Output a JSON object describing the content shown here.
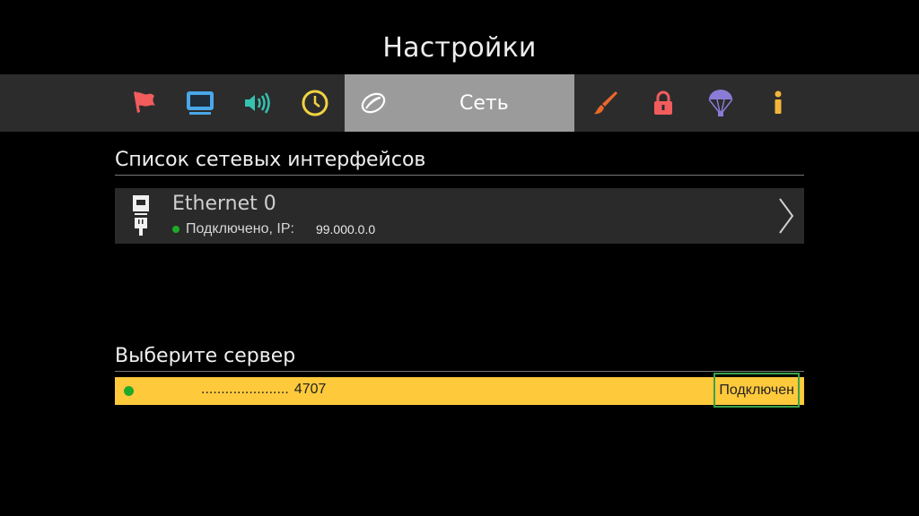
{
  "header": {
    "title": "Настройки"
  },
  "tabs": [
    {
      "name": "flag-icon",
      "color": "#f25c5c"
    },
    {
      "name": "tv-icon",
      "color": "#4aa7e8"
    },
    {
      "name": "sound-icon",
      "color": "#35c2b0"
    },
    {
      "name": "clock-icon",
      "color": "#f1d242"
    },
    {
      "name": "network-icon",
      "label": "Сеть",
      "active": true
    },
    {
      "name": "brush-icon",
      "color": "#e8682b"
    },
    {
      "name": "lock-icon",
      "color": "#f25c5c"
    },
    {
      "name": "parachute-icon",
      "color": "#8a7bd6"
    },
    {
      "name": "info-icon",
      "color": "#f2b53a"
    }
  ],
  "interfaces": {
    "title": "Список сетевых интерфейсов",
    "items": [
      {
        "name": "Ethernet 0",
        "status": "Подключено, IP:",
        "ip": "99.000.0.0",
        "status_color": "#1faa2a"
      }
    ]
  },
  "servers": {
    "title": "Выберите сервер",
    "items": [
      {
        "address": "......................",
        "port": "4707",
        "status": "Подключен",
        "highlight_color": "#ffc93c"
      }
    ]
  }
}
